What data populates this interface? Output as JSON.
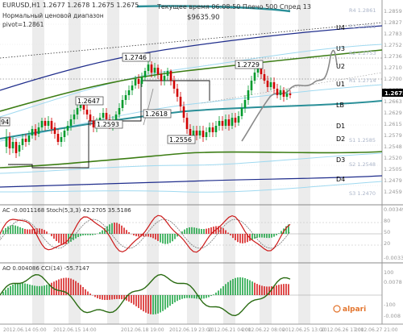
{
  "header": {
    "symbol_line": "EURUSD,H1  1.2677 1.2678 1.2675 1.2675",
    "indicator_name": "Нормальный ценовой диапазон",
    "pivot_line": "pivot=1.2861",
    "server_time": "Текущее время 06:08:50 Плечо 500 Спред 13",
    "balance": "$9635.90"
  },
  "price_labels": [
    "1.2859",
    "1.2827",
    "1.2783",
    "1.2752",
    "1.2736",
    "1.2710",
    "1.2700",
    "1.2675",
    "1.2663",
    "1.2629",
    "1.2615",
    "1.2579",
    "1.2548",
    "1.2520",
    "1.2505",
    "1.2479",
    "1.2459"
  ],
  "current_price": "1.2675",
  "level_labels": [
    "U4",
    "U3",
    "U2",
    "U1",
    "LB",
    "D1",
    "D2",
    "D3",
    "D4"
  ],
  "faint_levels": [
    "R4 1.2861",
    "R3 1.2821",
    "R2 1.2753",
    "R1 1.2714",
    "S1 1.2585",
    "S2 1.2548",
    "S3 1.2470"
  ],
  "annotations": [
    "1.2746",
    "1.2729",
    "1.2647",
    "1.2593",
    "1.2618",
    "1.2556"
  ],
  "left_partial_label": "94",
  "ac_panel": {
    "header": "AC -0.0011168  Stoch(5,3,3) 42.2705 35.5186",
    "right_values": [
      "0.003499",
      "80",
      "50",
      "20",
      "-0.00333"
    ]
  },
  "ao_panel": {
    "header": "AO 0.004086  CCI(14) -55.7147",
    "right_values": [
      "100",
      "0.0078",
      "-100",
      "-0.008"
    ]
  },
  "brand": "alpari",
  "time_axis": [
    "2012.06.14 05:00",
    "2012.06.15 14:00",
    "2012.06.18 19:00",
    "2012.06.19 23:00",
    "2012.06.21 04:00",
    "2012.06.22 08:00",
    "2012.06.25 13:00",
    "2012.06.26 17:00",
    "2012.06.27 21:00"
  ],
  "colors": {
    "bull": "#009a2c",
    "bear": "#d10000",
    "band_teal": "#2a8f98",
    "band_navy": "#1f2d8c",
    "band_olive": "#3c7d14",
    "band_cyan": "#9fd9f0",
    "stoch": "#cc1a1a",
    "cci": "#2a6b12"
  }
}
